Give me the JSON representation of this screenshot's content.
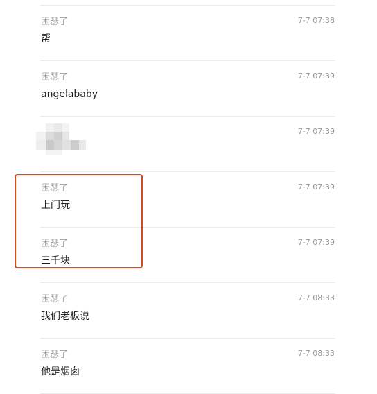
{
  "messages": [
    {
      "sender": "困瑟了",
      "time": "7-7 07:38",
      "content": "帮"
    },
    {
      "sender": "困瑟了",
      "time": "7-7 07:39",
      "content": "angelababy"
    },
    {
      "sender": "困瑟了",
      "time": "7-7 07:39",
      "content": ""
    },
    {
      "sender": "困瑟了",
      "time": "7-7 07:39",
      "content": "上门玩"
    },
    {
      "sender": "困瑟了",
      "time": "7-7 07:39",
      "content": "三千块"
    },
    {
      "sender": "困瑟了",
      "time": "7-7 08:33",
      "content": "我们老板说"
    },
    {
      "sender": "困瑟了",
      "time": "7-7 08:33",
      "content": "他是烟囱"
    }
  ],
  "colors": {
    "highlight_border": "#d9472b",
    "sender_text": "#a6a6a6",
    "time_text": "#9a9a9a",
    "content_text": "#222222",
    "divider": "#ececec"
  }
}
